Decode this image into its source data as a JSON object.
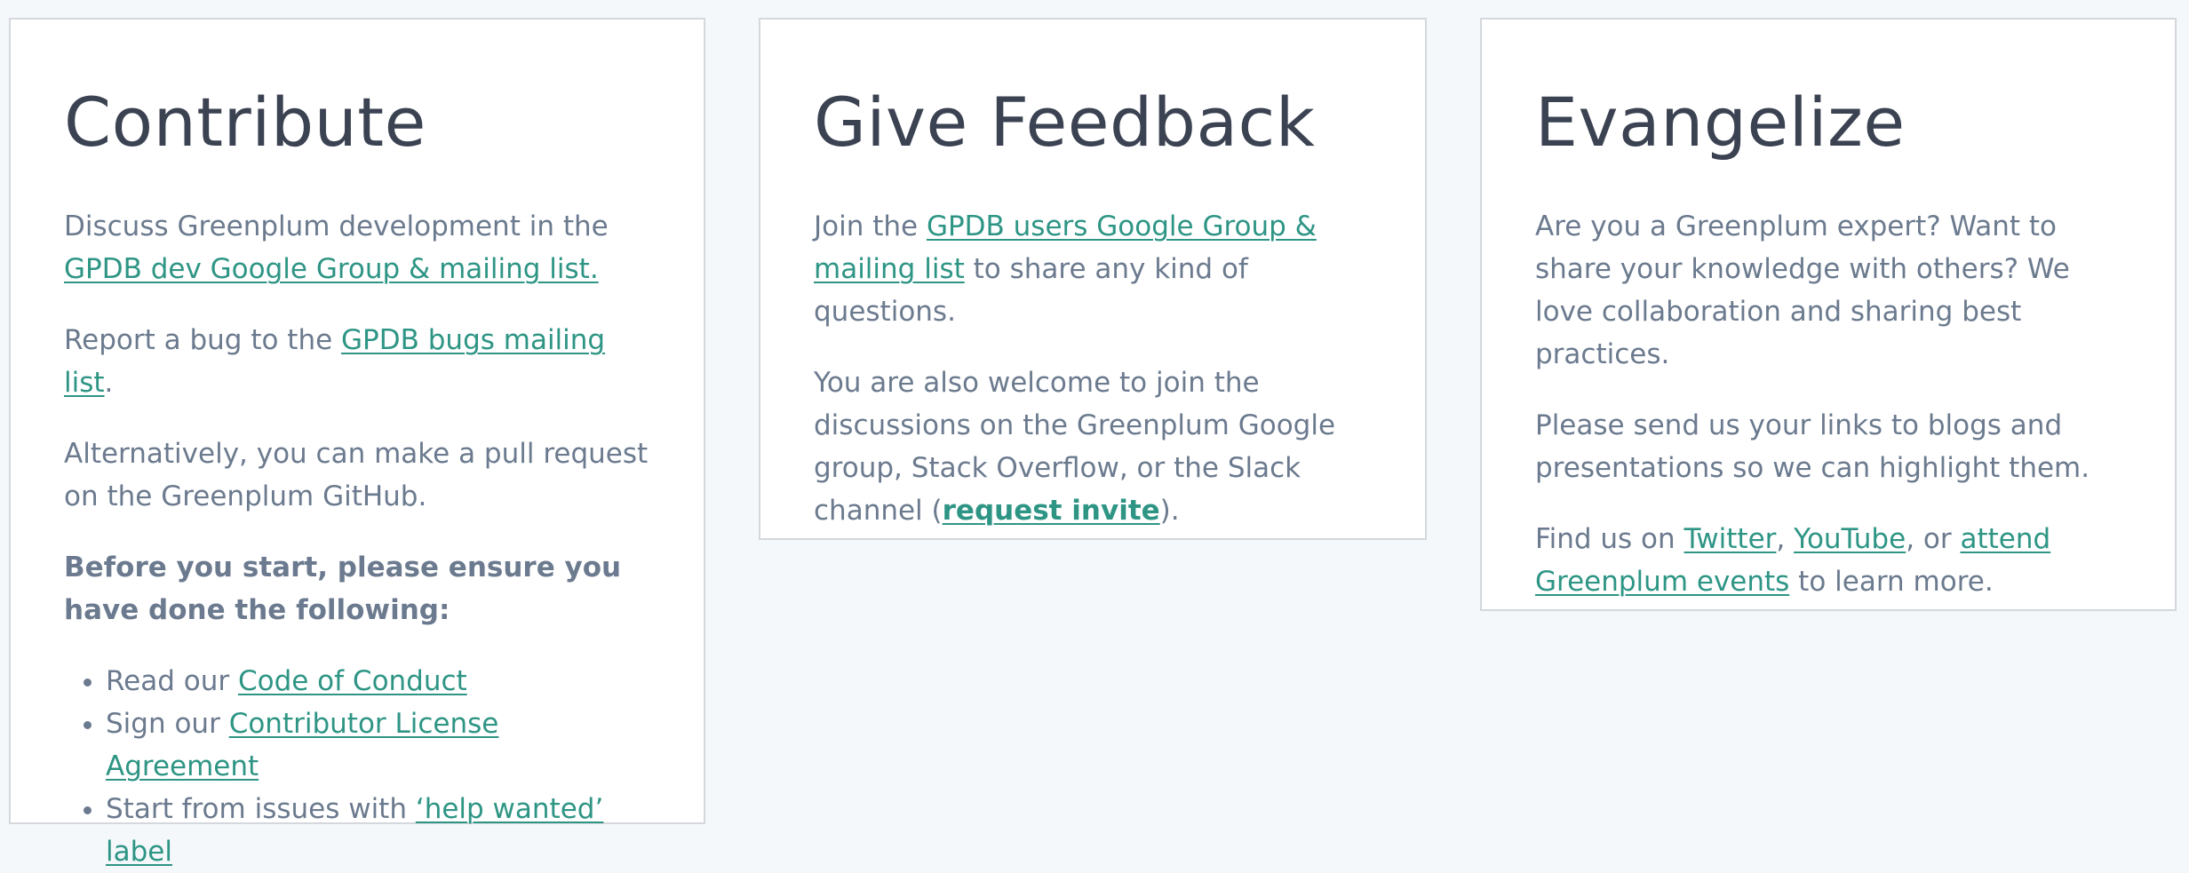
{
  "contribute": {
    "title": "Contribute",
    "p1_text": "Discuss Greenplum development in the ",
    "p1_link": "GPDB dev Google Group & mailing list.",
    "p2_text": "Report a bug to the ",
    "p2_link": "GPDB bugs mailing list",
    "p2_tail": ".",
    "p3_text": "Alternatively, you can make a pull request on the Greenplum GitHub.",
    "p4_text": "Before you start, please ensure you have done the following:",
    "list": [
      {
        "text": "Read our ",
        "link": "Code of Conduct"
      },
      {
        "text": "Sign our ",
        "link": "Contributor License Agreement"
      },
      {
        "text": "Start from issues with ",
        "link": "‘help wanted’ label"
      }
    ]
  },
  "feedback": {
    "title": "Give Feedback",
    "p1_text": "Join the ",
    "p1_link": "GPDB users Google Group & mailing list",
    "p1_tail": " to share any kind of questions.",
    "p2_text": "You are also welcome to join the discussions on the Greenplum Google group, Stack Overflow, or the Slack channel (",
    "p2_link": "request invite",
    "p2_tail": ")."
  },
  "evangelize": {
    "title": "Evangelize",
    "p1_text": "Are you a Greenplum expert? Want to share your knowledge with others? We love collaboration and sharing best practices.",
    "p2_text": "Please send us your links to blogs and presentations so we can highlight them.",
    "p3_text": "Find us on ",
    "p3_link_twitter": "Twitter",
    "p3_sep1": ", ",
    "p3_link_youtube": "YouTube",
    "p3_sep2": ", or ",
    "p3_link_events": "attend Greenplum events",
    "p3_tail": " to learn more."
  },
  "colors": {
    "background": "#f4f8fb",
    "card": "#ffffff",
    "heading": "#3b4252",
    "body_text": "#6b7a8e",
    "link": "#2e9585",
    "border": "#d4d8dd"
  }
}
